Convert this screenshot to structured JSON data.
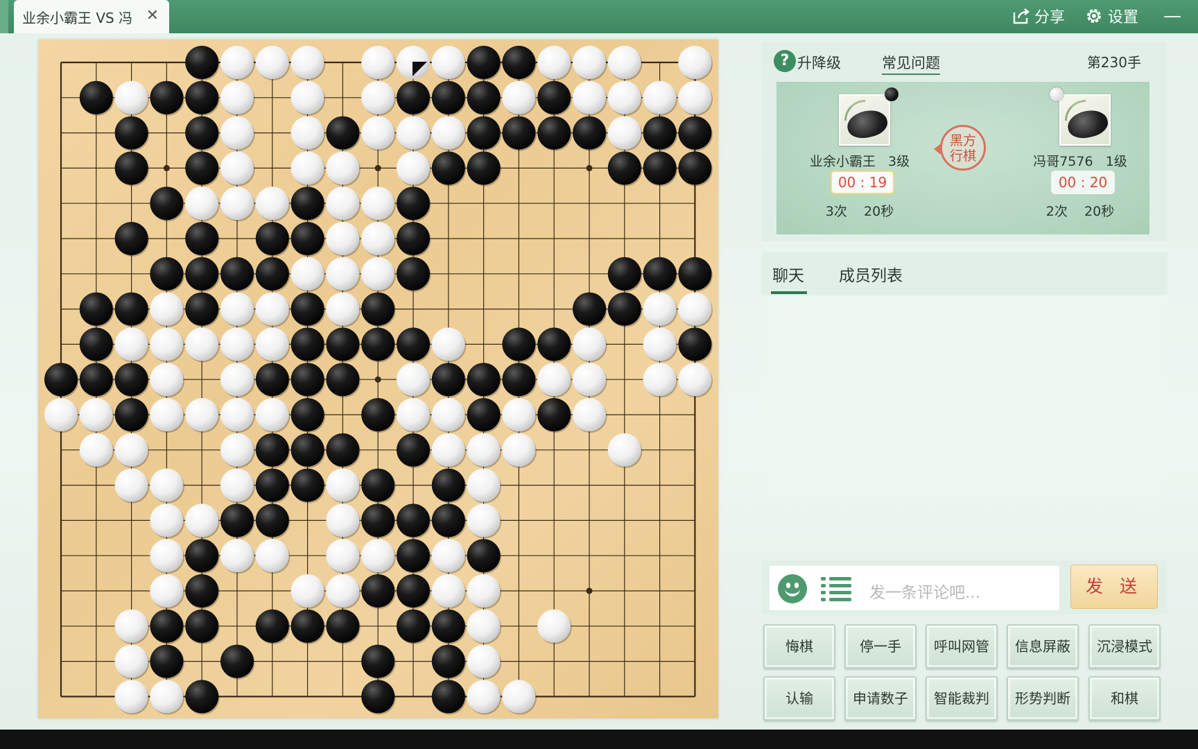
{
  "window": {
    "tab_title": "业余小霸王 VS 冯",
    "share_label": "分享",
    "settings_label": "设置",
    "minimize_symbol": "—",
    "close_symbol": "✕"
  },
  "info": {
    "level_label": "升降级",
    "faq_label": "常见问题",
    "move_count": "第230手",
    "turn_indicator": "黑方行棋",
    "black_player": {
      "name": "业余小霸王",
      "rank": "3级",
      "timer": "00 : 19",
      "byoyomi": "3次",
      "byoyomi_time": "20秒"
    },
    "white_player": {
      "name": "冯哥7576",
      "rank": "1级",
      "timer": "00 : 20",
      "byoyomi": "2次",
      "byoyomi_time": "20秒"
    }
  },
  "chat": {
    "tabs": [
      "聊天",
      "成员列表"
    ],
    "placeholder": "发一条评论吧...",
    "send_label": "发 送"
  },
  "actions": {
    "row1": [
      "悔棋",
      "停一手",
      "呼叫网管",
      "信息屏蔽",
      "沉浸模式"
    ],
    "row2": [
      "认输",
      "申请数子",
      "智能裁判",
      "形势判断",
      "和棋"
    ]
  },
  "colors": {
    "titlebar": "#4a9470",
    "board": "#f0d39f",
    "accent": "#2c7a52",
    "timer_text": "#d94b3c",
    "send_text": "#c0413a"
  },
  "board": {
    "size": 19,
    "hoshi": [
      [
        3,
        3
      ],
      [
        9,
        3
      ],
      [
        15,
        3
      ],
      [
        3,
        9
      ],
      [
        9,
        9
      ],
      [
        15,
        9
      ],
      [
        3,
        15
      ],
      [
        9,
        15
      ],
      [
        15,
        15
      ]
    ],
    "last_move": [
      10,
      0
    ],
    "rows": [
      "....BWWW.W.WBBWWW.W",
      ".BWBBW.W.WBBBWBWWWW",
      "..B.BW.WBWWWBBBBWBB",
      "..B.BW.WW.WBB...BBB",
      "...BWWWBWWB........",
      "..B.B.BBWWB........",
      "...BBBBWWWB.....BBB",
      ".BBWBWWBWB.....BBWW",
      ".BWWWWWBBBBW.BBW.WB",
      "BBBW.WBBB.WBBBWW.WW",
      "WWBWWWWB.BWWBWBW...",
      ".WW..WBBB.BWWW..W..",
      "..WW.WBBWB.BW......",
      "...WWBB.WBBBW......",
      "...WBWW.WWBWB......",
      "...WB..WWBBWW......",
      "..WBB.BBB.BBW.W....",
      "..WB.B...B.BW......",
      "..WWB....B.BWW....."
    ]
  }
}
